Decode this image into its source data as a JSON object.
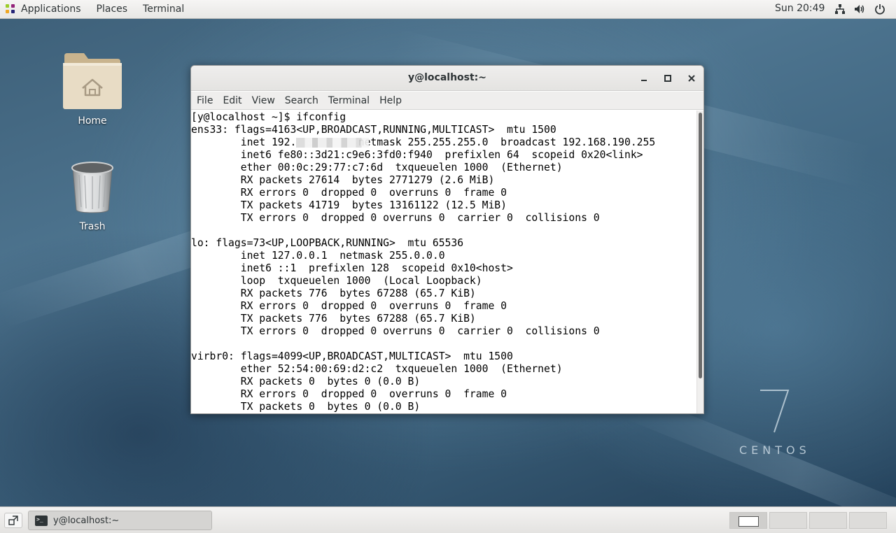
{
  "topbar": {
    "applications_label": "Applications",
    "places_label": "Places",
    "terminal_label": "Terminal",
    "clock": "Sun 20:49",
    "icons": [
      "network-icon",
      "volume-icon",
      "power-icon"
    ]
  },
  "desktop": {
    "icons": [
      {
        "label": "Home",
        "icon": "home-folder-icon"
      },
      {
        "label": "Trash",
        "icon": "trash-icon"
      }
    ],
    "watermark": {
      "number": "7",
      "text": "CENTOS"
    }
  },
  "window": {
    "title": "y@localhost:~",
    "controls": [
      "minimize-icon",
      "maximize-icon",
      "close-icon"
    ],
    "menu": [
      "File",
      "Edit",
      "View",
      "Search",
      "Terminal",
      "Help"
    ],
    "terminal_lines": [
      "[y@localhost ~]$ ifconfig",
      "ens33: flags=4163<UP,BROADCAST,RUNNING,MULTICAST>  mtu 1500",
      "        inet 192.          netmask 255.255.255.0  broadcast 192.168.190.255",
      "        inet6 fe80::3d21:c9e6:3fd0:f940  prefixlen 64  scopeid 0x20<link>",
      "        ether 00:0c:29:77:c7:6d  txqueuelen 1000  (Ethernet)",
      "        RX packets 27614  bytes 2771279 (2.6 MiB)",
      "        RX errors 0  dropped 0  overruns 0  frame 0",
      "        TX packets 41719  bytes 13161122 (12.5 MiB)",
      "        TX errors 0  dropped 0 overruns 0  carrier 0  collisions 0",
      "",
      "lo: flags=73<UP,LOOPBACK,RUNNING>  mtu 65536",
      "        inet 127.0.0.1  netmask 255.0.0.0",
      "        inet6 ::1  prefixlen 128  scopeid 0x10<host>",
      "        loop  txqueuelen 1000  (Local Loopback)",
      "        RX packets 776  bytes 67288 (65.7 KiB)",
      "        RX errors 0  dropped 0  overruns 0  frame 0",
      "        TX packets 776  bytes 67288 (65.7 KiB)",
      "        TX errors 0  dropped 0 overruns 0  carrier 0  collisions 0",
      "",
      "virbr0: flags=4099<UP,BROADCAST,MULTICAST>  mtu 1500",
      "        ether 52:54:00:69:d2:c2  txqueuelen 1000  (Ethernet)",
      "        RX packets 0  bytes 0 (0.0 B)",
      "        RX errors 0  dropped 0  overruns 0  frame 0",
      "        TX packets 0  bytes 0 (0.0 B)"
    ]
  },
  "taskbar": {
    "task_label": "y@localhost:~",
    "workspaces": 4,
    "active_workspace": 1
  }
}
